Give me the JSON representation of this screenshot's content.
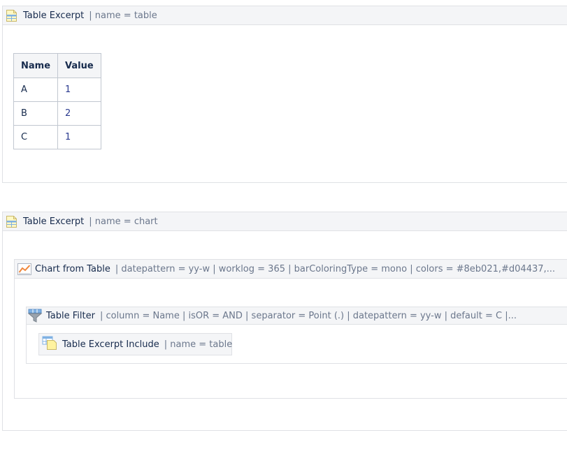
{
  "macros": {
    "table_excerpt_1": {
      "title": "Table Excerpt",
      "params": "| name = table",
      "icon": "table-excerpt-icon"
    },
    "table_excerpt_2": {
      "title": "Table Excerpt",
      "params": "| name = chart",
      "icon": "table-excerpt-icon"
    },
    "chart_from_table": {
      "title": "Chart from Table",
      "params": "| datepattern = yy-w | worklog = 365 | barColoringType = mono | colors = #8eb021,#d04437,...",
      "icon": "chart-icon"
    },
    "table_filter": {
      "title": "Table Filter",
      "params": "| column = Name | isOR = AND | separator = Point (.) | datepattern = yy-w | default = C |...",
      "icon": "funnel-icon"
    },
    "table_excerpt_include": {
      "title": "Table Excerpt Include",
      "params": "| name = table",
      "icon": "table-excerpt-include-icon"
    }
  },
  "table": {
    "headers": [
      "Name",
      "Value"
    ],
    "rows": [
      [
        "A",
        "1"
      ],
      [
        "B",
        "2"
      ],
      [
        "C",
        "1"
      ]
    ]
  },
  "colors": {
    "header_bg": "#f4f5f7",
    "border": "#dfe1e5",
    "param_text": "#6b778c",
    "icon_yellow": "#fff3a0",
    "icon_blue": "#4a90d9",
    "chart_orange": "#f0883e"
  }
}
